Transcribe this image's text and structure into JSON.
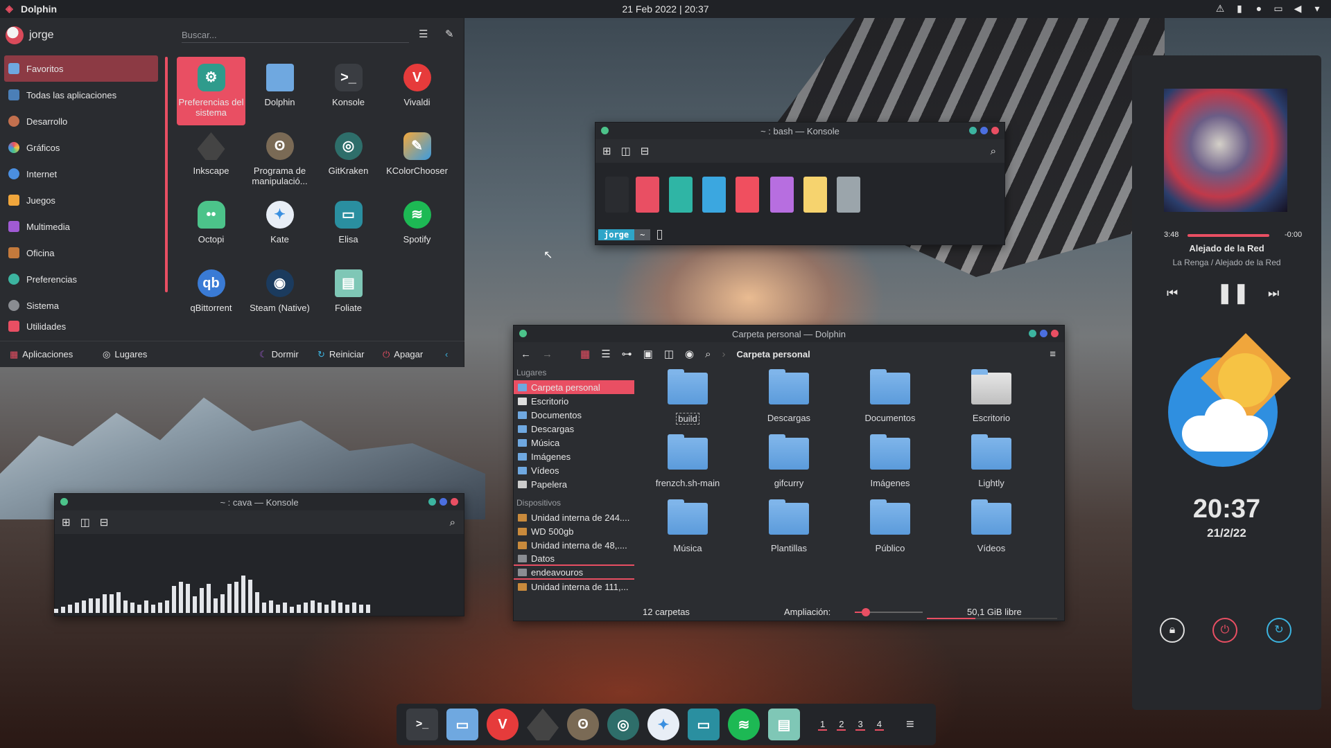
{
  "topbar": {
    "app_name": "Dolphin",
    "clock": "21 Feb 2022 | 20:37"
  },
  "launcher": {
    "user": "jorge",
    "search_placeholder": "Buscar...",
    "categories": [
      "Favoritos",
      "Todas las aplicaciones",
      "Desarrollo",
      "Gráficos",
      "Internet",
      "Juegos",
      "Multimedia",
      "Oficina",
      "Preferencias",
      "Sistema",
      "Utilidades"
    ],
    "apps": [
      "Preferencias del sistema",
      "Dolphin",
      "Konsole",
      "Vivaldi",
      "Inkscape",
      "Programa de manipulació...",
      "GitKraken",
      "KColorChooser",
      "Octopi",
      "Kate",
      "Elisa",
      "Spotify",
      "qBittorrent",
      "Steam (Native)",
      "Foliate"
    ],
    "footer": {
      "apps": "Aplicaciones",
      "places": "Lugares",
      "sleep": "Dormir",
      "restart": "Reiniciar",
      "shutdown": "Apagar"
    }
  },
  "konsole_bash": {
    "title": "~ : bash — Konsole",
    "prompt_user": "jorge",
    "prompt_path": "~"
  },
  "konsole_cava": {
    "title": "~ : cava — Konsole",
    "bar_levels": [
      4,
      6,
      8,
      10,
      12,
      14,
      14,
      18,
      18,
      20,
      12,
      10,
      8,
      12,
      8,
      10,
      12,
      26,
      30,
      28,
      16,
      24,
      28,
      14,
      18,
      28,
      30,
      36,
      32,
      20,
      10,
      12,
      8,
      10,
      6,
      8,
      10,
      12,
      10,
      8,
      12,
      10,
      8,
      10,
      8,
      8
    ]
  },
  "dolphin": {
    "title": "Carpeta personal — Dolphin",
    "breadcrumb": "Carpeta personal",
    "places_header": "Lugares",
    "devices_header": "Dispositivos",
    "places": [
      "Carpeta personal",
      "Escritorio",
      "Documentos",
      "Descargas",
      "Música",
      "Imágenes",
      "Vídeos",
      "Papelera"
    ],
    "devices": [
      "Unidad interna de 244....",
      "WD 500gb",
      "Unidad interna de 48,....",
      "Datos",
      "endeavouros",
      "Unidad interna de 111,..."
    ],
    "folders": [
      "build",
      "Descargas",
      "Documentos",
      "Escritorio",
      "frenzch.sh-main",
      "gifcurry",
      "Imágenes",
      "Lightly",
      "Música",
      "Plantillas",
      "Público",
      "Vídeos"
    ],
    "status": "12 carpetas",
    "zoom_label": "Ampliación:",
    "free": "50,1 GiB libre"
  },
  "player": {
    "elapsed": "3:48",
    "remaining": "-0:00",
    "title": "Alejado de la Red",
    "artist": "La Renga / Alejado de la Red",
    "progress": 0.97
  },
  "clock_widget": {
    "time": "20:37",
    "date": "21/2/22"
  },
  "dock": {
    "pager": [
      "1",
      "2",
      "3",
      "4"
    ]
  }
}
